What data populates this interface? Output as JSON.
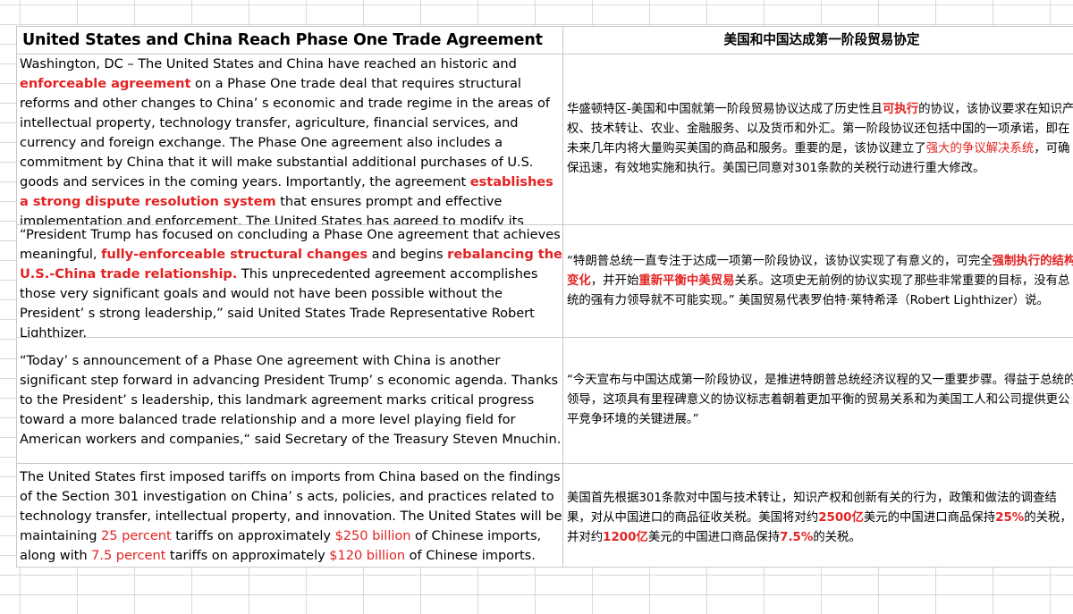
{
  "header": {
    "title_en": "United States and China Reach Phase One Trade Agreement",
    "title_zh": "美国和中国达成第一阶段贸易协定"
  },
  "rows": [
    {
      "en": [
        {
          "t": "Washington, DC –  The United States and China have reached an historic and "
        },
        {
          "t": "enforceable agreement",
          "hl": true
        },
        {
          "t": " on a Phase One trade deal that requires structural reforms and other changes to China’ s economic and trade regime in the areas of intellectual property, technology transfer, agriculture, financial services, and currency and foreign exchange.  The Phase One agreement also includes a commitment by China that it will make substantial additional purchases of U.S. goods and services in the coming years.  Importantly, the agreement "
        },
        {
          "t": "establishes a strong dispute resolution system",
          "hl": true
        },
        {
          "t": " that ensures prompt and effective implementation and enforcement.  The United States has agreed to modify its"
        }
      ],
      "zh": [
        {
          "t": "华盛顿特区-美国和中国就第一阶段贸易协议达成了历史性且"
        },
        {
          "t": "可执行",
          "hl": true
        },
        {
          "t": "的协议，该协议要求在知识产权、技术转让、农业、金融服务、以及货币和外汇。第一阶段协议还包括中国的一项承诺，即在未来几年内将大量购买美国的商品和服务。重要的是，该协议建立了"
        },
        {
          "t": "强大的争议解决系统",
          "hlp": true
        },
        {
          "t": "，可确保迅速，有效地实施和执行。美国已同意对301条款的关税行动进行重大修改。"
        }
      ]
    },
    {
      "en": [
        {
          "t": " “President Trump has focused on concluding a Phase One agreement that achieves meaningful, "
        },
        {
          "t": "fully-enforceable structural changes",
          "hl": true
        },
        {
          "t": " and begins "
        },
        {
          "t": "rebalancing the U.S.-China trade relationship.",
          "hl": true
        },
        {
          "t": "  This unprecedented agreement accomplishes those very significant goals and would not have been possible without the President’ s strong leadership,”  said United States Trade Representative Robert Lighthizer."
        }
      ],
      "zh": [
        {
          "t": " “特朗普总统一直专注于达成一项第一阶段协议，该协议实现了有意义的，可完全"
        },
        {
          "t": "强制执行的结构变化",
          "hl": true
        },
        {
          "t": "，并开始"
        },
        {
          "t": "重新平衡中美贸易",
          "hl": true
        },
        {
          "t": "关系。这项史无前例的协议实现了那些非常重要的目标，没有总统的强有力领导就不可能实现。” 美国贸易代表罗伯特·莱特希泽（Robert Lighthizer）说。"
        }
      ]
    },
    {
      "en": [
        {
          "t": " “Today’ s announcement of a Phase One agreement with China is another significant step forward in advancing President Trump’ s economic agenda.  Thanks to the President’ s leadership, this landmark agreement marks critical progress toward a more balanced trade relationship and a more level playing field for American workers and companies,“  said Secretary of the Treasury Steven Mnuchin."
        }
      ],
      "zh": [
        {
          "t": " “今天宣布与中国达成第一阶段协议，是推进特朗普总统经济议程的又一重要步骤。得益于总统的领导，这项具有里程碑意义的协议标志着朝着更加平衡的贸易关系和为美国工人和公司提供更公平竞争环境的关键进展。”"
        }
      ]
    },
    {
      "en": [
        {
          "t": "The United States first imposed tariffs on imports from China based on the findings of the Section 301 investigation on China’ s acts, policies, and practices related to technology transfer, intellectual property, and innovation.  The United States will be maintaining "
        },
        {
          "t": "25 percent",
          "hlp": true
        },
        {
          "t": " tariffs on approximately "
        },
        {
          "t": "$250 billion",
          "hlp": true
        },
        {
          "t": " of Chinese imports, along with "
        },
        {
          "t": "7.5 percent",
          "hlp": true
        },
        {
          "t": " tariffs on approximately "
        },
        {
          "t": "$120 billion",
          "hlp": true
        },
        {
          "t": " of Chinese imports."
        }
      ],
      "zh": [
        {
          "t": "美国首先根据301条款对中国与技术转让，知识产权和创新有关的行为，政策和做法的调查结果，对从中国进口的商品征收关税。美国将对约"
        },
        {
          "t": "2500亿",
          "hl": true
        },
        {
          "t": "美元的中国进口商品保持"
        },
        {
          "t": "25%",
          "hl": true
        },
        {
          "t": "的关税，并对约"
        },
        {
          "t": "1200亿",
          "hl": true
        },
        {
          "t": "美元的中国进口商品保持"
        },
        {
          "t": "7.5%",
          "hl": true
        },
        {
          "t": "的关税。"
        }
      ]
    }
  ],
  "colors": {
    "highlight": "#e32323",
    "gridline": "#d9d9d9"
  }
}
